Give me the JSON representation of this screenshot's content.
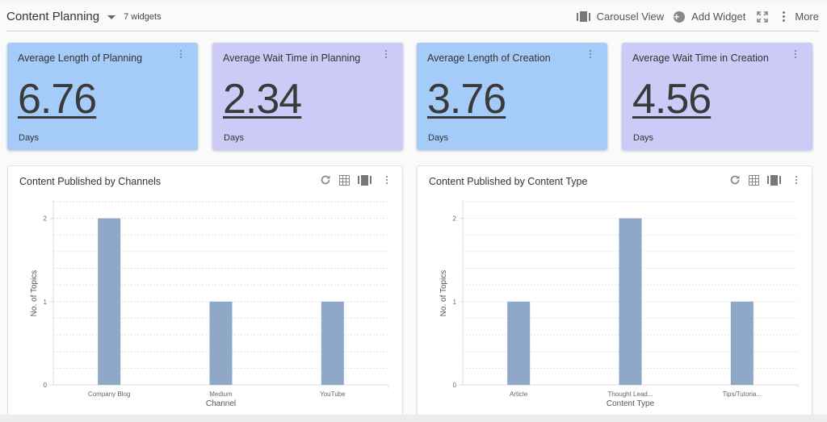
{
  "header": {
    "title": "Content Planning",
    "widget_count": "7 widgets",
    "toolbar": {
      "carousel_view": "Carousel View",
      "add_widget": "Add Widget",
      "more": "More"
    },
    "icons": {
      "carousel": "carousel-icon",
      "add": "plus-circle-icon",
      "expand": "expand-icon",
      "more": "more-vertical-icon"
    }
  },
  "kpis": [
    {
      "title": "Average Length of Planning",
      "value": "6.76",
      "unit": "Days",
      "color": "#a5cbf8"
    },
    {
      "title": "Average Wait Time in Planning",
      "value": "2.34",
      "unit": "Days",
      "color": "#cccaf6"
    },
    {
      "title": "Average Length of Creation",
      "value": "3.76",
      "unit": "Days",
      "color": "#a5cbf8"
    },
    {
      "title": "Average Wait Time in Creation",
      "value": "4.56",
      "unit": "Days",
      "color": "#cccaf6"
    }
  ],
  "chart_data": [
    {
      "type": "bar",
      "title": "Content Published by Channels",
      "categories": [
        "Company Blog",
        "Medium",
        "YouTube"
      ],
      "values": [
        2,
        1,
        1
      ],
      "xlabel": "Channel",
      "ylabel": "No. of Topics",
      "ylim": [
        0,
        2.2
      ],
      "yticks": [
        0,
        1,
        2
      ],
      "grid_step": 0.2,
      "grid": true,
      "bar_color": "#8fa8c8"
    },
    {
      "type": "bar",
      "title": "Content Published by Content Type",
      "categories": [
        "Article",
        "Thought Lead...",
        "Tips/Tutoria..."
      ],
      "values": [
        1,
        2,
        1
      ],
      "xlabel": "Content Type",
      "ylabel": "No. of Topics",
      "ylim": [
        0,
        2.2
      ],
      "yticks": [
        0,
        1,
        2
      ],
      "grid_step": 0.2,
      "grid": true,
      "bar_color": "#8fa8c8"
    }
  ]
}
